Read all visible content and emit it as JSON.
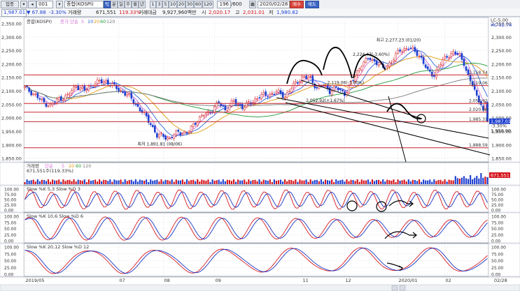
{
  "toolbar": {
    "market": "업종",
    "code": "001",
    "chart_kind": "종합(KOSPI)",
    "periods": [
      "틱",
      "분",
      "일",
      "주",
      "월",
      "년"
    ],
    "intervals": [
      "1",
      "3",
      "5",
      "10",
      "20",
      "30",
      "60",
      "120"
    ],
    "count": "196",
    "count_total": "/600",
    "date": "2020/02/28",
    "buy": "매수",
    "sell": "매도"
  },
  "quote": {
    "price": "1,987.01",
    "change": "▼ 67.88",
    "pct": "-3.30%",
    "vol_label": "거래량",
    "volume": "671,551",
    "vol_pct": "119.33%",
    "amt_label": "거래대금",
    "amount": "9,927,960백만",
    "open_label": "시",
    "open": "2,020.17",
    "high_label": "고",
    "high": "2,031.01",
    "low_label": "저",
    "low": "1,980.82"
  },
  "colors": {
    "up": "#d4141c",
    "down": "#1d3fd0",
    "ma5": "#d46fd4",
    "ma10": "#2b62d6",
    "ma20": "#e09a10",
    "ma60": "#1f9a3a",
    "ma120": "#7a7a7a",
    "hline": "#c8242c",
    "slow_k": "#d6191f",
    "slow_d": "#1733c4",
    "drawing": "#000000"
  },
  "chart_data": [
    {
      "type": "candlestick",
      "title": "종합(KOSPI)",
      "legend": [
        {
          "name": "종가 단순",
          "color": "#d46fd4"
        },
        {
          "name": "5",
          "color": "#d46fd4"
        },
        {
          "name": "10",
          "color": "#2b62d6"
        },
        {
          "name": "20",
          "color": "#e09a10"
        },
        {
          "name": "60",
          "color": "#1f9a3a"
        },
        {
          "name": "120",
          "color": "#7a7a7a"
        }
      ],
      "ylim": [
        1836,
        2372
      ],
      "yticks": [
        "2,350.00",
        "2,300.00",
        "2,250.00",
        "2,200.00",
        "2,150.00",
        "2,100.00",
        "2,050.00",
        "2,000.00",
        "1,950.00",
        "1,900.00",
        "1,850.00"
      ],
      "yticks_values": [
        2350,
        2300,
        2250,
        2200,
        2150,
        2100,
        2050,
        2000,
        1950,
        1900,
        1850
      ],
      "xticks": [
        {
          "label": "2019/05",
          "index": 0
        },
        {
          "label": "07",
          "index": 44
        },
        {
          "label": "08",
          "index": 65
        },
        {
          "label": "09",
          "index": 89
        },
        {
          "label": "11",
          "index": 130
        },
        {
          "label": "12",
          "index": 150
        },
        {
          "label": "2020/01",
          "index": 175
        },
        {
          "label": "02",
          "index": 197
        }
      ],
      "n_bars": 218,
      "close_anchors": [
        [
          0,
          2110
        ],
        [
          4,
          2090
        ],
        [
          8,
          2060
        ],
        [
          12,
          2045
        ],
        [
          16,
          2070
        ],
        [
          20,
          2080
        ],
        [
          24,
          2120
        ],
        [
          28,
          2100
        ],
        [
          33,
          2130
        ],
        [
          38,
          2135
        ],
        [
          43,
          2110
        ],
        [
          47,
          2090
        ],
        [
          50,
          2070
        ],
        [
          53,
          2040
        ],
        [
          56,
          2010
        ],
        [
          59,
          1980
        ],
        [
          62,
          1930
        ],
        [
          65,
          1935
        ],
        [
          68,
          1920
        ],
        [
          72,
          1950
        ],
        [
          76,
          1940
        ],
        [
          80,
          1985
        ],
        [
          84,
          2010
        ],
        [
          88,
          2030
        ],
        [
          91,
          2055
        ],
        [
          94,
          2030
        ],
        [
          98,
          2060
        ],
        [
          102,
          2040
        ],
        [
          106,
          2055
        ],
        [
          110,
          2080
        ],
        [
          114,
          2085
        ],
        [
          118,
          2095
        ],
        [
          122,
          2080
        ],
        [
          126,
          2120
        ],
        [
          130,
          2150
        ],
        [
          134,
          2145
        ],
        [
          137,
          2110
        ],
        [
          140,
          2120
        ],
        [
          143,
          2100
        ],
        [
          146,
          2110
        ],
        [
          150,
          2090
        ],
        [
          154,
          2140
        ],
        [
          158,
          2200
        ],
        [
          162,
          2220
        ],
        [
          166,
          2200
        ],
        [
          168,
          2180
        ],
        [
          172,
          2210
        ],
        [
          176,
          2250
        ],
        [
          180,
          2260
        ],
        [
          184,
          2240
        ],
        [
          186,
          2220
        ],
        [
          189,
          2170
        ],
        [
          192,
          2160
        ],
        [
          195,
          2200
        ],
        [
          198,
          2230
        ],
        [
          201,
          2240
        ],
        [
          204,
          2230
        ],
        [
          206,
          2205
        ],
        [
          208,
          2150
        ],
        [
          210,
          2120
        ],
        [
          212,
          2080
        ],
        [
          214,
          2055
        ],
        [
          216,
          1987
        ]
      ],
      "hlines": [
        {
          "value": 2158.74,
          "label": "2,158.74"
        },
        {
          "value": 2119.06,
          "label": "2,119.06"
        },
        {
          "value": 2052.92,
          "label": "2,052.92"
        },
        {
          "value": 2020.58,
          "label": "2,020.58"
        },
        {
          "value": 1985.31,
          "label": "1,985.31"
        },
        {
          "value": 1888.59,
          "label": "1,888.59"
        }
      ],
      "annotations": [
        {
          "text": "최고 2,277.23 (01/20)",
          "x": 178,
          "y": 2277.23
        },
        {
          "text": "최저 1,891.81 (08/06)",
          "x": 66,
          "y": 1891.81
        },
        {
          "text": "2,224.47(-3.60%)",
          "x": 167,
          "y": 2224.47
        },
        {
          "text": "2,119.06(-3.60%)",
          "x": 155,
          "y": 2119.06
        },
        {
          "text": "2,052.92(+1.67%)",
          "x": 145,
          "y": 2052.92
        }
      ],
      "right_labels": {
        "top": "LC-5.00",
        "top2": "HC-52.74",
        "last_price": "1,987.01",
        "last_pct": "-3.30%",
        "last_level": "1,950.00"
      }
    },
    {
      "type": "bar",
      "title": "거래량",
      "legend": [
        {
          "name": "단순",
          "color": "#d46fd4"
        },
        {
          "name": "5",
          "color": "#d46fd4"
        },
        {
          "name": "20",
          "color": "#e09a10"
        },
        {
          "name": "60",
          "color": "#1f9a3a"
        },
        {
          "name": "120",
          "color": "#7a7a7a"
        }
      ],
      "subtitle": "671,551주(119.33%)",
      "right_label": "671,551"
    },
    {
      "type": "line",
      "title": "Slow %K 5,3  Slow %D 3",
      "series": [
        {
          "name": "Slow %K 5,3",
          "color": "#d6191f",
          "period": 10
        },
        {
          "name": "Slow %D 3",
          "color": "#1733c4",
          "period": 10
        }
      ],
      "ylim": [
        0,
        100
      ],
      "yticks": [
        "100.00",
        "75.00",
        "50.00",
        "25.00",
        "0.00"
      ]
    },
    {
      "type": "line",
      "title": "Slow %K 10,6  Slow %D 6",
      "series": [
        {
          "name": "Slow %K 10,6",
          "color": "#d6191f",
          "period": 18
        },
        {
          "name": "Slow %D 6",
          "color": "#1733c4",
          "period": 18
        }
      ],
      "ylim": [
        0,
        100
      ],
      "yticks": [
        "100.00",
        "75.00",
        "50.00",
        "25.00",
        "0.00"
      ]
    },
    {
      "type": "line",
      "title": "Slow %K 20,12  Slow %D 12",
      "series": [
        {
          "name": "Slow %K 20,12",
          "color": "#d6191f",
          "period": 32
        },
        {
          "name": "Slow %D 12",
          "color": "#1733c4",
          "period": 32
        }
      ],
      "ylim": [
        0,
        100
      ],
      "yticks": [
        "100.00",
        "75.00",
        "50.00",
        "25.00",
        "0.00"
      ]
    }
  ],
  "bottom_axis_right": "02/28"
}
